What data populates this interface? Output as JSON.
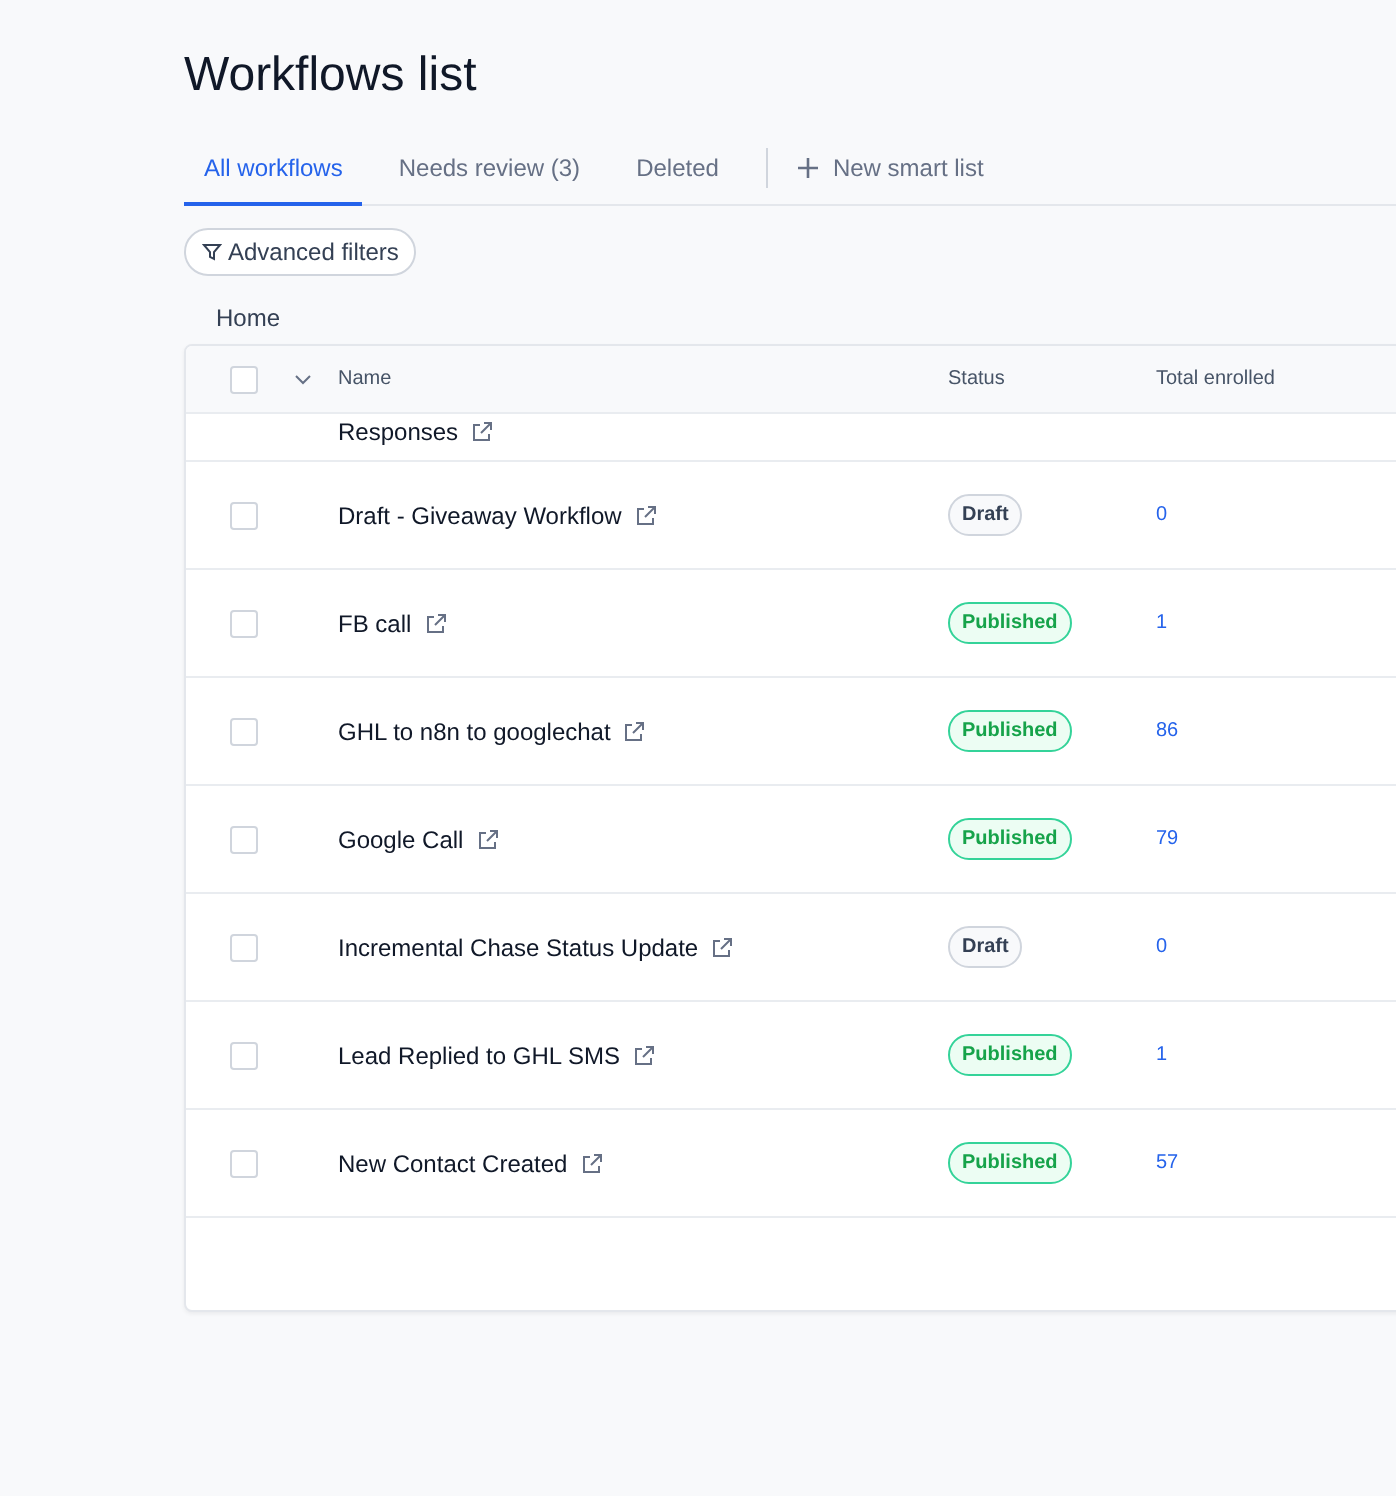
{
  "page_title": "Workflows list",
  "tabs": [
    {
      "label": "All workflows",
      "selected": true
    },
    {
      "label": "Needs review (3)",
      "selected": false
    },
    {
      "label": "Deleted",
      "selected": false
    }
  ],
  "new_list_button": "New smart list",
  "filter_button": "Advanced filters",
  "folder": "Home",
  "table": {
    "select_all_checked": false,
    "columns": [
      "Name",
      "Status",
      "Total enrolled"
    ],
    "partial_row": {
      "name": "Responses"
    },
    "rows": [
      {
        "name": "Draft - Giveaway Workflow",
        "status": "Draft",
        "kind": "draft",
        "enrolled": "0",
        "checked": false
      },
      {
        "name": "FB call",
        "status": "Published",
        "kind": "published",
        "enrolled": "1",
        "checked": false
      },
      {
        "name": "GHL to n8n to googlechat",
        "status": "Published",
        "kind": "published",
        "enrolled": "86",
        "checked": false
      },
      {
        "name": "Google Call",
        "status": "Published",
        "kind": "published",
        "enrolled": "79",
        "checked": false
      },
      {
        "name": "Incremental Chase Status Update",
        "status": "Draft",
        "kind": "draft",
        "enrolled": "0",
        "checked": false
      },
      {
        "name": "Lead Replied to GHL SMS",
        "status": "Published",
        "kind": "published",
        "enrolled": "1",
        "checked": false
      },
      {
        "name": "New Contact Created",
        "status": "Published",
        "kind": "published",
        "enrolled": "57",
        "checked": false
      }
    ]
  }
}
